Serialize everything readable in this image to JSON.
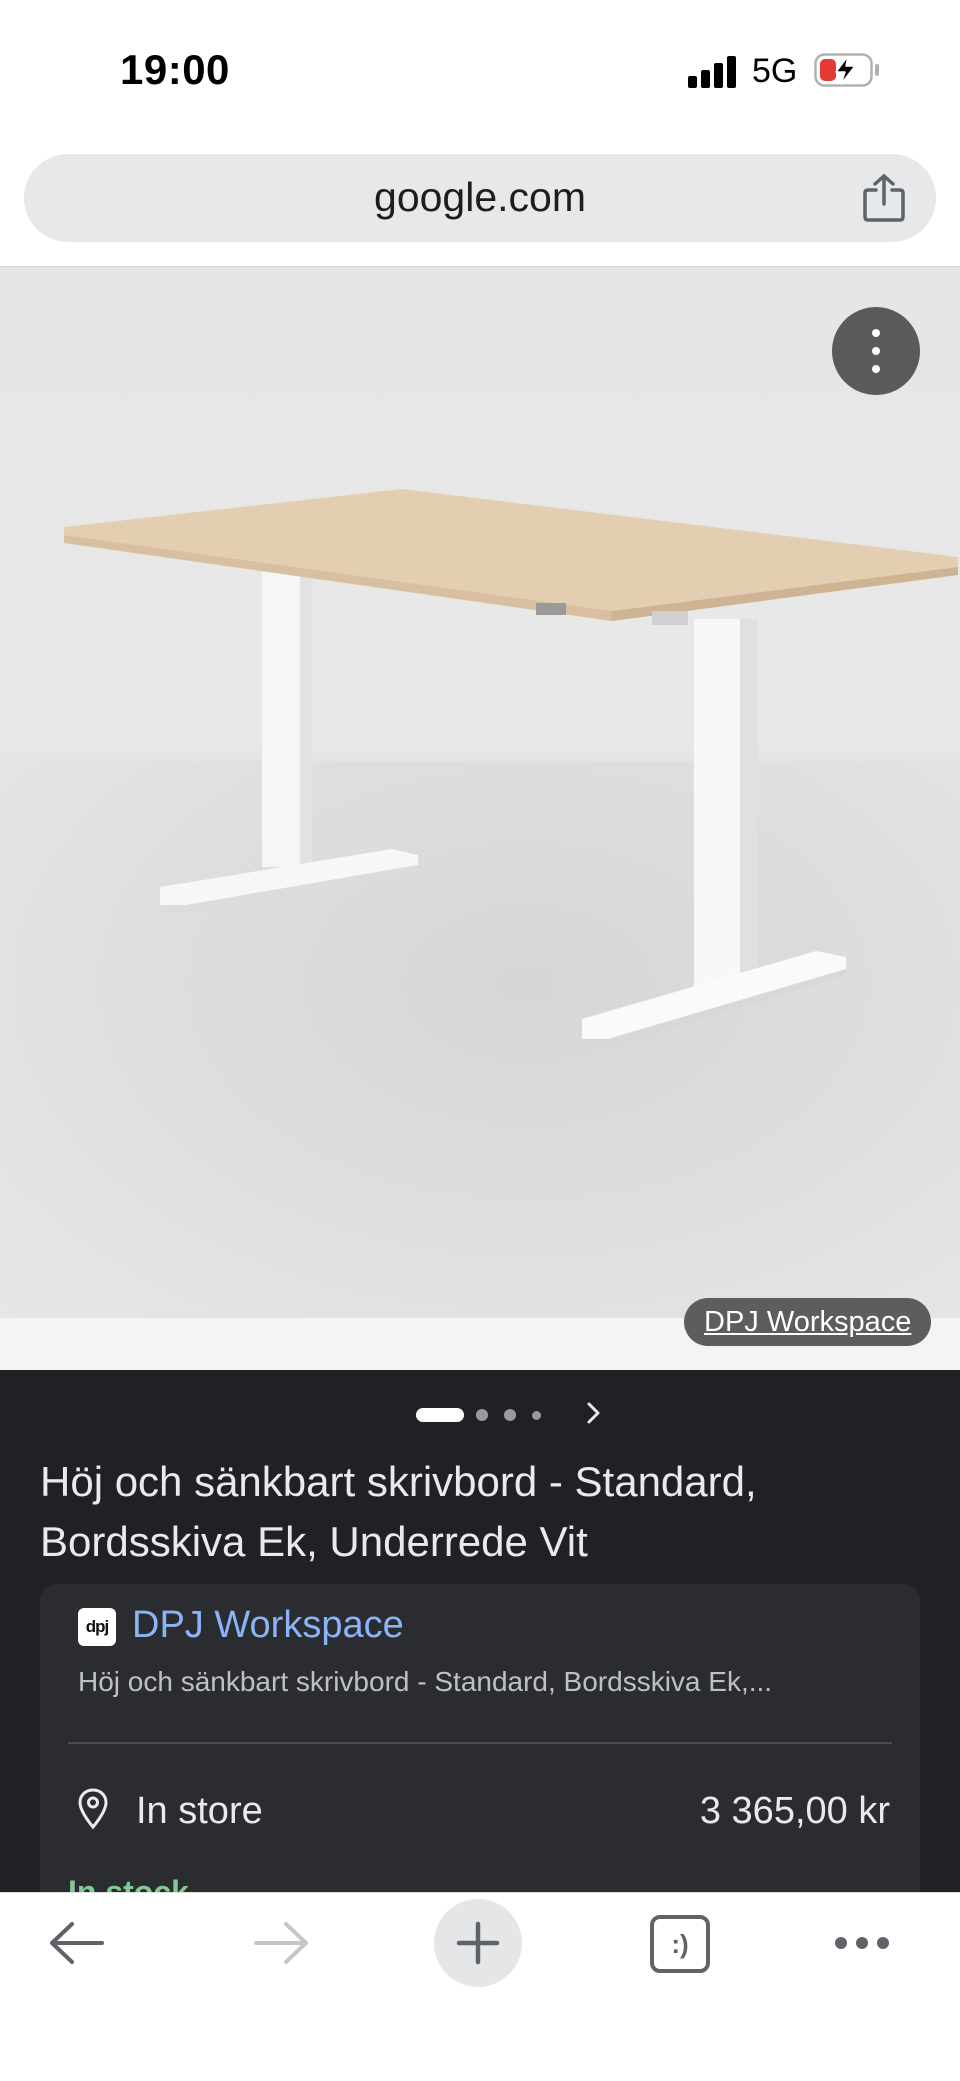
{
  "status_bar": {
    "time": "19:00",
    "network": "5G",
    "icons": [
      "signal-bars-icon",
      "battery-charging-icon"
    ]
  },
  "address_bar": {
    "url": "google.com",
    "icons": [
      "share-icon"
    ]
  },
  "image_viewer": {
    "source_label": "DPJ Workspace",
    "icons": [
      "more-vertical-icon"
    ],
    "carousel": {
      "total": 4,
      "active_index": 0
    }
  },
  "product": {
    "title": "Höj och sänkbart skrivbord - Standard, Bordsskiva Ek, Underrede Vit",
    "offer": {
      "merchant_logo": "dpj",
      "merchant_name": "DPJ Workspace",
      "description": "Höj och sänkbart skrivbord - Standard, Bordsskiva Ek,...",
      "availability_label": "In store",
      "price": "3 365,00 kr",
      "stock": "In stock"
    }
  },
  "toolbar": {
    "icons": [
      "back-arrow-icon",
      "forward-arrow-icon",
      "new-tab-plus-icon",
      "tabs-icon",
      "more-horizontal-icon"
    ],
    "tabs_label": ":)"
  },
  "colors": {
    "dark_background": "#202124",
    "card_background": "#2b2c2f",
    "link_blue": "#8ab4f8",
    "stock_green": "#81c995",
    "battery_red": "#e53935"
  }
}
